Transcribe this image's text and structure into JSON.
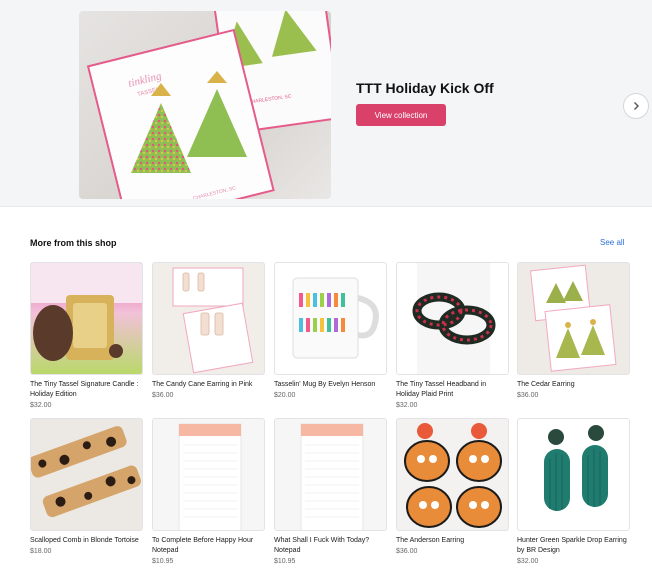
{
  "hero": {
    "title": "TTT Holiday Kick Off",
    "button_label": "View collection",
    "card_texts": [
      "tinkling",
      "TASSEL",
      "CHARLESTON, SC",
      "CHARLESTON, SC"
    ]
  },
  "section": {
    "title": "More from this shop",
    "see_all": "See all"
  },
  "products_row1": [
    {
      "name": "The Tiny Tassel Signature Candle : Holiday Edition",
      "price": "$32.00"
    },
    {
      "name": "The Candy Cane Earring in Pink",
      "price": "$36.00"
    },
    {
      "name": "Tasselin' Mug By Evelyn Henson",
      "price": "$20.00"
    },
    {
      "name": "The Tiny Tassel Headband in Holiday Plaid Print",
      "price": "$32.00"
    },
    {
      "name": "The Cedar Earring",
      "price": "$36.00"
    }
  ],
  "products_row2": [
    {
      "name": "Scalloped Comb in Blonde Tortoise",
      "price": "$18.00"
    },
    {
      "name": "To Complete Before Happy Hour Notepad",
      "price": "$10.95"
    },
    {
      "name": "What Shall I Fuck With Today? Notepad",
      "price": "$10.95"
    },
    {
      "name": "The Anderson Earring",
      "price": "$36.00"
    },
    {
      "name": "Hunter Green Sparkle Drop Earring by BR Design",
      "price": "$32.00"
    }
  ],
  "colors": {
    "accent": "#d9416a",
    "link": "#2e6fdb"
  },
  "icons": {
    "next": "chevron-right-icon"
  }
}
